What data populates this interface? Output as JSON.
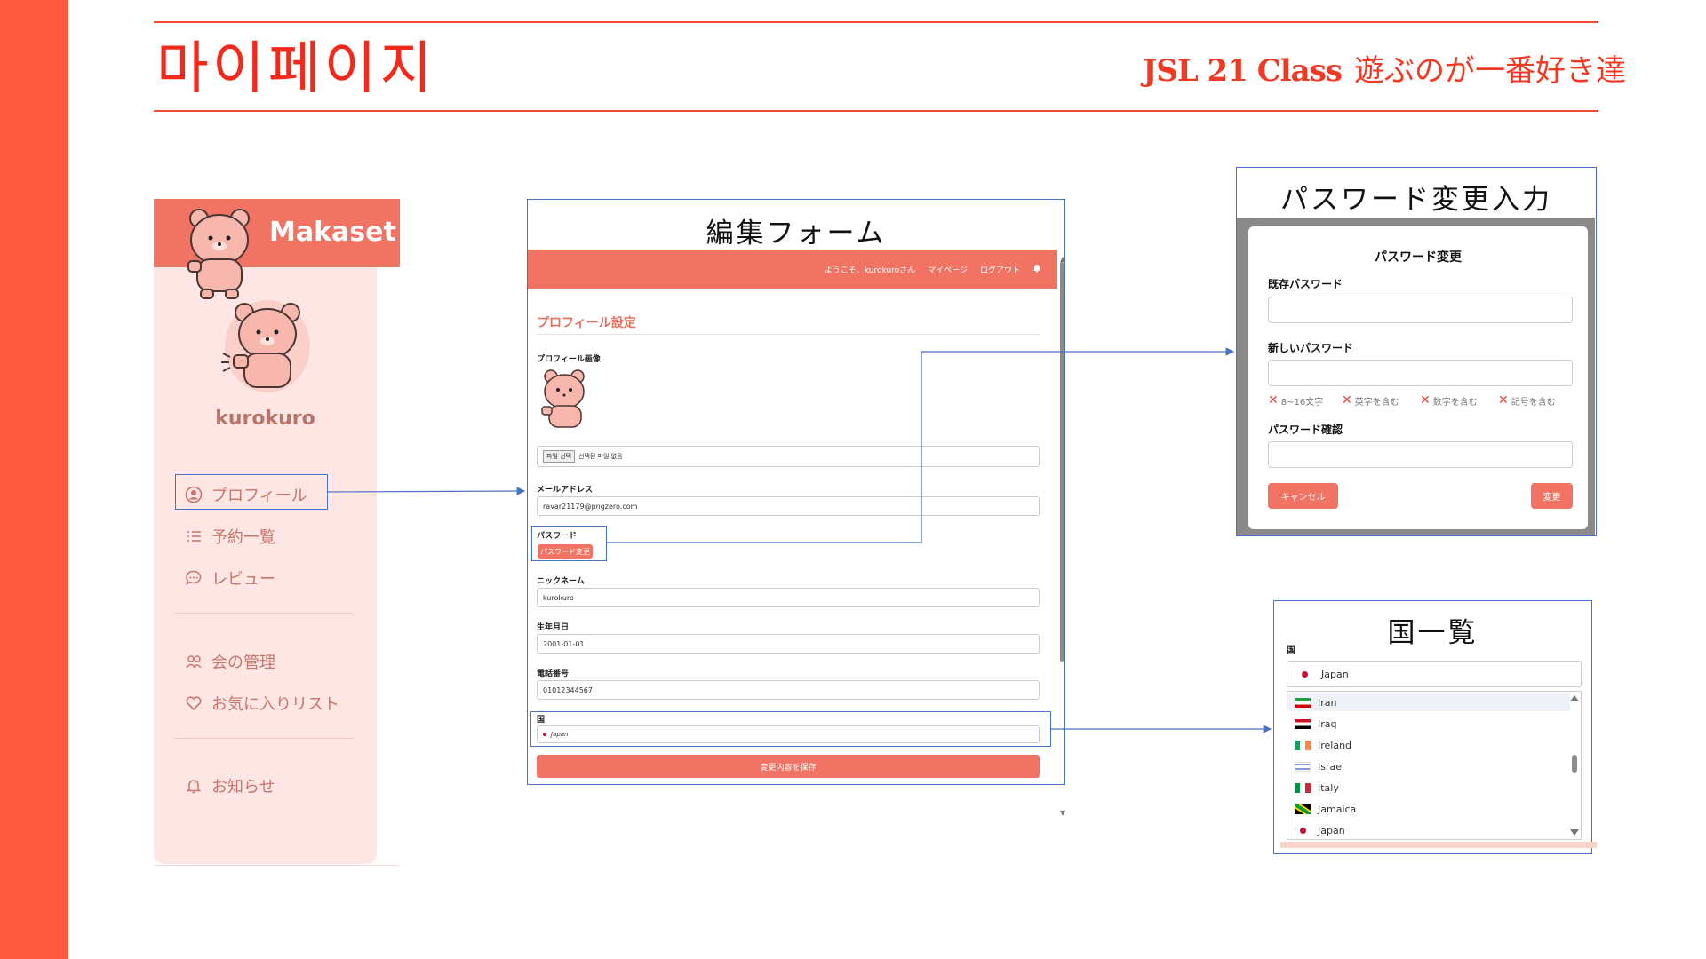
{
  "header": {
    "title": "마이페이지",
    "class_name": "JSL 21 Class",
    "team_name": "遊ぶのが一番好き達"
  },
  "sidebar": {
    "brand": "Makaset",
    "username": "kurokuro",
    "items": [
      {
        "label": "プロフィール",
        "icon": "user-circle-icon"
      },
      {
        "label": "予約一覧",
        "icon": "list-icon"
      },
      {
        "label": "レビュー",
        "icon": "chat-bubble-icon"
      },
      {
        "label": "会の管理",
        "icon": "users-icon"
      },
      {
        "label": "お気に入りリスト",
        "icon": "heart-icon"
      },
      {
        "label": "お知らせ",
        "icon": "bell-icon"
      }
    ]
  },
  "edit_form": {
    "panel_title": "編集フォーム",
    "nav": {
      "welcome": "ようこそ、kurokuroさん",
      "mypage": "マイページ",
      "logout": "ログアウト"
    },
    "heading": "プロフィール設定",
    "profile_image_label": "プロフィール画像",
    "file_button": "파일 선택",
    "file_status": "선택된 파일 없음",
    "email_label": "メールアドレス",
    "email_value": "ravar21179@pngzero.com",
    "password_label": "パスワード",
    "password_button": "パスワード変更",
    "nickname_label": "ニックネーム",
    "nickname_value": "kurokuro",
    "birthday_label": "生年月日",
    "birthday_value": "2001-01-01",
    "phone_label": "電話番号",
    "phone_value": "01012344567",
    "country_label": "国",
    "country_value": "Japan",
    "save_button": "変更内容を保存"
  },
  "password_panel": {
    "panel_title": "パスワード変更入力",
    "heading": "パスワード変更",
    "current_label": "既存パスワード",
    "new_label": "新しいパスワード",
    "rules": [
      "8~16文字",
      "英字を含む",
      "数字を含む",
      "記号を含む"
    ],
    "confirm_label": "パスワード確認",
    "cancel_button": "キャンセル",
    "submit_button": "変更"
  },
  "country_panel": {
    "panel_title": "国一覧",
    "label": "国",
    "selected": "Japan",
    "options": [
      "Iran",
      "Iraq",
      "Ireland",
      "Israel",
      "Italy",
      "Jamaica",
      "Japan"
    ]
  },
  "colors": {
    "accent": "#f07363",
    "title_red": "#f22a1c",
    "strip": "#ff5a3e",
    "sidebar_bg": "#fde6e3",
    "connector_blue": "#4a72c2"
  }
}
